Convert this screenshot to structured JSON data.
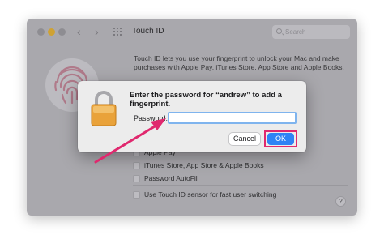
{
  "window": {
    "title": "Touch ID",
    "search_placeholder": "Search",
    "description": "Touch ID lets you use your fingerprint to unlock your Mac and make purchases with Apple Pay, iTunes Store, App Store and Apple Books.",
    "options": [
      {
        "label": "Apple Pay"
      },
      {
        "label": "iTunes Store, App Store & Apple Books"
      },
      {
        "label": "Password AutoFill"
      },
      {
        "label": "Use Touch ID sensor for fast user switching"
      }
    ],
    "help_label": "?"
  },
  "dialog": {
    "message": "Enter the password for “andrew” to add a fingerprint.",
    "password_label": "Password:",
    "password_value": "",
    "cancel_label": "Cancel",
    "ok_label": "OK"
  },
  "colors": {
    "accent_blue": "#2e83f5",
    "highlight_pink": "#e0286e"
  }
}
